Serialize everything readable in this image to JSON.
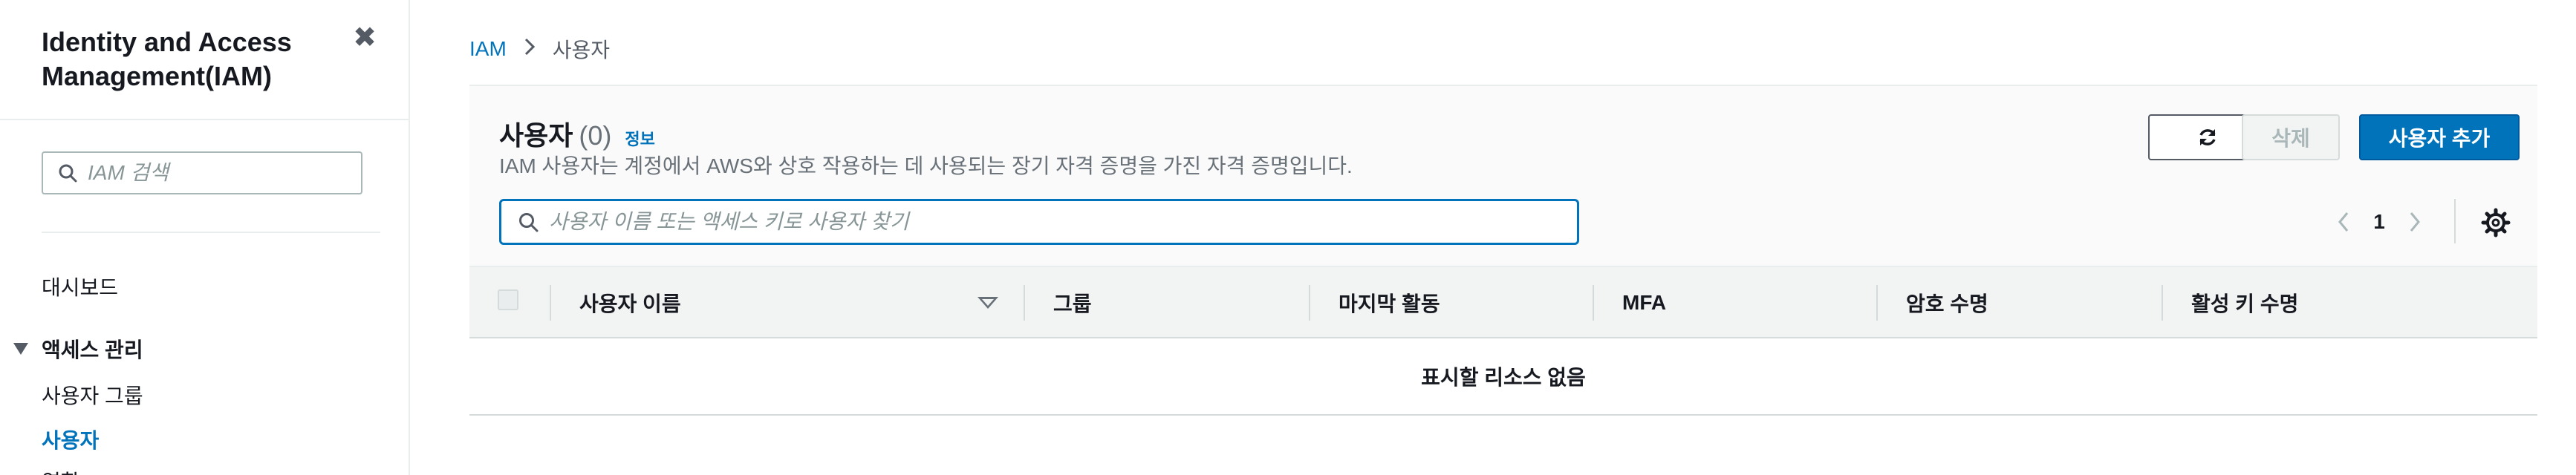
{
  "sidebar": {
    "title": "Identity and Access Management(IAM)",
    "close_glyph": "✖",
    "search_placeholder": "IAM 검색",
    "dashboard": "대시보드",
    "section_access": "액세스 관리",
    "item_user_groups": "사용자 그룹",
    "item_users": "사용자",
    "item_roles_partial": "역할"
  },
  "breadcrumb": {
    "root": "IAM",
    "separator": ">",
    "current": "사용자"
  },
  "panel": {
    "title": "사용자",
    "count": "(0)",
    "info_link": "정보",
    "description": "IAM 사용자는 계정에서 AWS와 상호 작용하는 데 사용되는 장기 자격 증명을 가진 자격 증명입니다.",
    "buttons": {
      "delete": "삭제",
      "add_user": "사용자 추가"
    },
    "search_placeholder": "사용자 이름 또는 액세스 키로 사용자 찾기",
    "pagination": {
      "prev": "‹",
      "page": "1",
      "next": "›"
    },
    "columns": [
      "사용자 이름",
      "그룹",
      "마지막 활동",
      "MFA",
      "암호 수명",
      "활성 키 수명"
    ],
    "empty_message": "표시할 리소스 없음"
  },
  "colors": {
    "accent": "#0073bb",
    "text": "#16191f",
    "muted": "#687078",
    "header_bg": "#f2f3f3"
  }
}
